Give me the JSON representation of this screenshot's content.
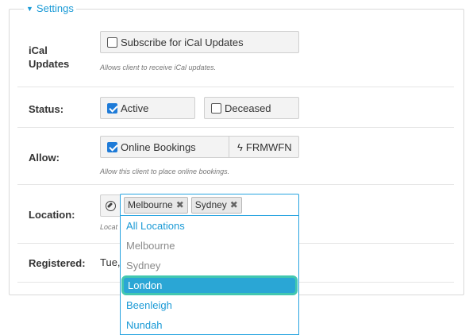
{
  "settings": {
    "legend": "Settings",
    "ical": {
      "label": "iCal Updates",
      "checkbox_label": "Subscribe for iCal Updates",
      "checked": false,
      "help": "Allows client to receive iCal updates."
    },
    "status": {
      "label": "Status:",
      "active_label": "Active",
      "active_checked": true,
      "deceased_label": "Deceased",
      "deceased_checked": false
    },
    "allow": {
      "label": "Allow:",
      "online_label": "Online Bookings",
      "online_checked": true,
      "code": "FRMWFN",
      "help": "Allow this client to place online bookings."
    },
    "location": {
      "label": "Location:",
      "selected": [
        "Melbourne",
        "Sydney"
      ],
      "help_visible": "Locat",
      "options": [
        {
          "label": "All Locations",
          "style": "blue"
        },
        {
          "label": "Melbourne",
          "style": "gray"
        },
        {
          "label": "Sydney",
          "style": "gray"
        },
        {
          "label": "London",
          "style": "highlight"
        },
        {
          "label": "Beenleigh",
          "style": "blue"
        },
        {
          "label": "Nundah",
          "style": "blue"
        }
      ]
    },
    "registered": {
      "label": "Registered:",
      "value_visible": "Tue,"
    }
  },
  "icons": {
    "legend_caret": "caret-down-icon",
    "allow_code": "lightning-icon",
    "location_locate": "compass-icon",
    "tag_remove": "close-icon"
  },
  "colors": {
    "accent": "#1a9ad6",
    "checkbox": "#1e7bd8",
    "highlight_bg": "#2aa6d5",
    "highlight_ring": "#42c7b0"
  }
}
